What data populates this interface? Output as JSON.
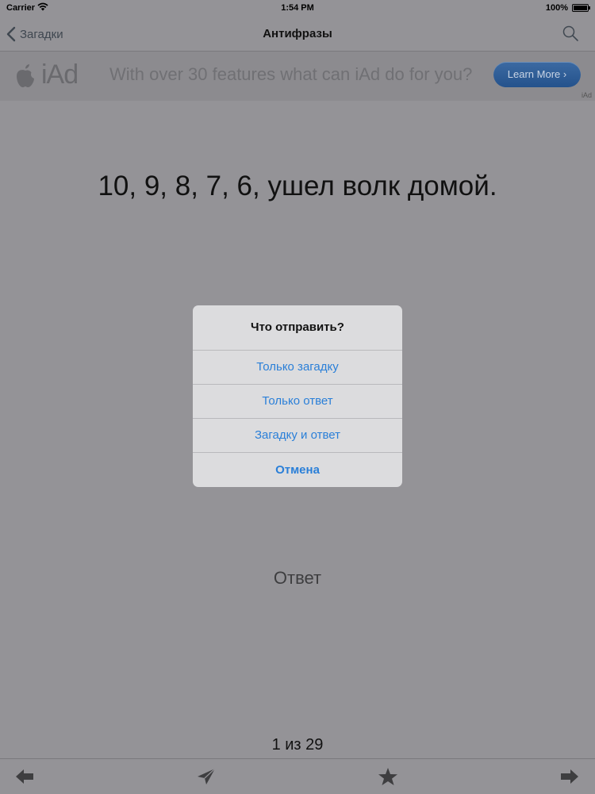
{
  "status_bar": {
    "carrier": "Carrier",
    "time": "1:54 PM",
    "battery": "100%"
  },
  "nav": {
    "back_label": "Загадки",
    "title": "Антифразы",
    "search_icon": "search-icon"
  },
  "ad": {
    "brand": "iAd",
    "headline": "With over 30 features what can iAd do for you?",
    "button_label": "Learn More ›",
    "tag": "iAd"
  },
  "content": {
    "phrase": "10, 9, 8, 7, 6, ушел волк домой.",
    "answer_label": "Ответ",
    "page_counter": "1 из 29"
  },
  "alert": {
    "title": "Что отправить?",
    "options": [
      "Только загадку",
      "Только ответ",
      "Загадку и ответ"
    ],
    "cancel": "Отмена"
  },
  "toolbar": {
    "items": [
      "arrow-left-icon",
      "send-icon",
      "star-icon",
      "arrow-right-icon"
    ]
  },
  "colors": {
    "dimmed_background": "#949397",
    "alert_background": "#dcdcde",
    "action_blue": "#2a7fd8"
  }
}
